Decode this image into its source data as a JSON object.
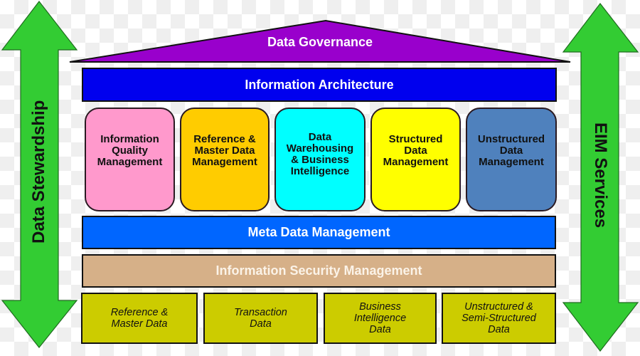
{
  "colors": {
    "arrow_green": "#33cc33",
    "governance_purple": "#9900cc",
    "architecture_blue": "#0000ee",
    "meta_blue": "#0066ff",
    "security_tan": "#d6b088",
    "data_olive": "#cccc00"
  },
  "left_arrow": {
    "label": "Data Stewardship",
    "icon": "double-headed-vertical-arrow"
  },
  "right_arrow": {
    "label": "EIM Services",
    "icon": "double-headed-vertical-arrow"
  },
  "roof": {
    "label": "Data Governance"
  },
  "architecture": {
    "label": "Information Architecture"
  },
  "pillars": [
    {
      "label": "Information\nQuality\nManagement",
      "color": "#ff99cc"
    },
    {
      "label": "Reference &\nMaster Data\nManagement",
      "color": "#ffcc00"
    },
    {
      "label": "Data\nWarehousing\n& Business\nIntelligence",
      "color": "#00ffff"
    },
    {
      "label": "Structured\nData\nManagement",
      "color": "#ffff00"
    },
    {
      "label": "Unstructured\nData\nManagement",
      "color": "#4f81bd"
    }
  ],
  "meta": {
    "label": "Meta Data Management"
  },
  "security": {
    "label": "Information Security Management"
  },
  "data_types": [
    {
      "label": "Reference &\nMaster Data"
    },
    {
      "label": "Transaction\nData"
    },
    {
      "label": "Business\nIntelligence\nData"
    },
    {
      "label": "Unstructured &\nSemi-Structured\nData"
    }
  ]
}
